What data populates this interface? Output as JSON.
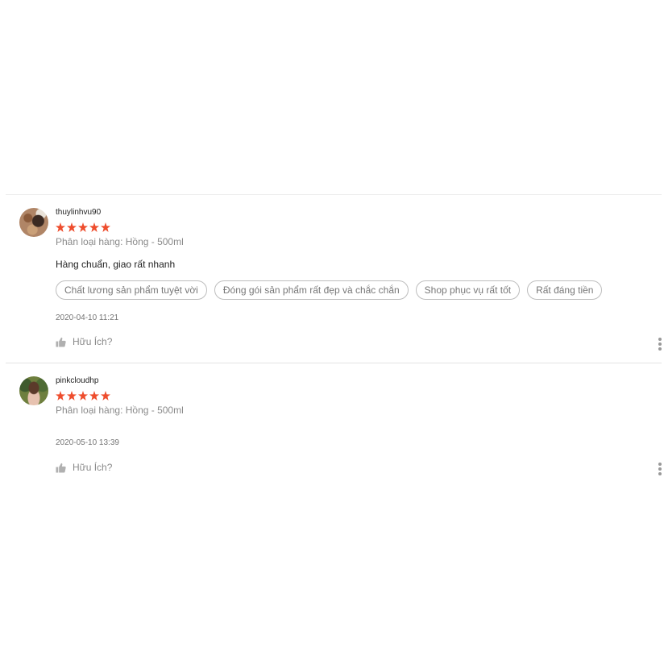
{
  "reviews": [
    {
      "username": "thuylinhvu90",
      "rating": 5,
      "variation": "Phân loại hàng: Hồng - 500ml",
      "comment": "Hàng chuẩn, giao rất nhanh",
      "tags": [
        "Chất lương sản phẩm tuyệt vời",
        "Đóng gói sản phẩm rất đẹp và chắc chắn",
        "Shop phục vụ rất tốt",
        "Rất đáng tiền"
      ],
      "time": "2020-04-10 11:21",
      "helpful_label": "Hữu Ích?"
    },
    {
      "username": "pinkcloudhp",
      "rating": 5,
      "variation": "Phân loại hàng: Hồng - 500ml",
      "time": "2020-05-10 13:39",
      "helpful_label": "Hữu Ích?"
    }
  ],
  "colors": {
    "star": "#ee4d2d",
    "muted_text": "#8a8a8a",
    "tag_border": "#bdbdbd"
  },
  "icons": {
    "helpful": "thumbs-up-icon",
    "more": "more-vertical-icon"
  }
}
